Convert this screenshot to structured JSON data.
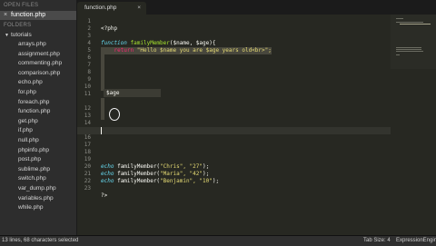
{
  "sidebar": {
    "open_files_header": "OPEN FILES",
    "open_file": "function.php",
    "folders_header": "FOLDERS",
    "folder": "tutorials",
    "files": [
      "arrays.php",
      "assignment.php",
      "commenting.php",
      "comparison.php",
      "echo.php",
      "for.php",
      "foreach.php",
      "function.php",
      "get.php",
      "if.php",
      "null.php",
      "phpinfo.php",
      "post.php",
      "sublime.php",
      "switch.php",
      "var_dump.php",
      "variables.php",
      "while.php"
    ]
  },
  "tab": {
    "label": "function.php",
    "close": "×"
  },
  "editor": {
    "line_numbers": [
      "1",
      "2",
      "3",
      "4",
      "5",
      "6",
      "7",
      "8",
      "9",
      "10",
      "11",
      "12",
      "13",
      "14",
      "15",
      "16",
      "17",
      "18",
      "19",
      "20",
      "21",
      "22",
      "23"
    ],
    "line1": "<?php",
    "line3_kw": "function",
    "line3_fn": "familyMember",
    "line3_rest": "($name, $age){",
    "line4_kw": "return",
    "line4_str": "\"Hello $name you are $age years old<br>\";",
    "autocomplete": "$age",
    "line20_echo": "echo",
    "line20_call": "familyMember(",
    "line20_args": "\"Chris\", \"27\"",
    "line20_end": ");",
    "line21_echo": "echo",
    "line21_call": "familyMember(",
    "line21_args": "\"Maria\", \"42\"",
    "line21_end": ");",
    "line22_echo": "echo",
    "line22_call": "familyMember(",
    "line22_args": "\"Benjamin\", \"10\"",
    "line22_end": ");",
    "line24": "?>"
  },
  "status": {
    "selection": "13 lines, 68 characters selected",
    "tab_size": "Tab Size: 4",
    "syntax": "ExpressionEngine"
  },
  "colors": {
    "background": "#272822",
    "keyword": "#66d9ef",
    "function": "#a6e22e",
    "string": "#e6db74",
    "operator": "#f92672"
  }
}
